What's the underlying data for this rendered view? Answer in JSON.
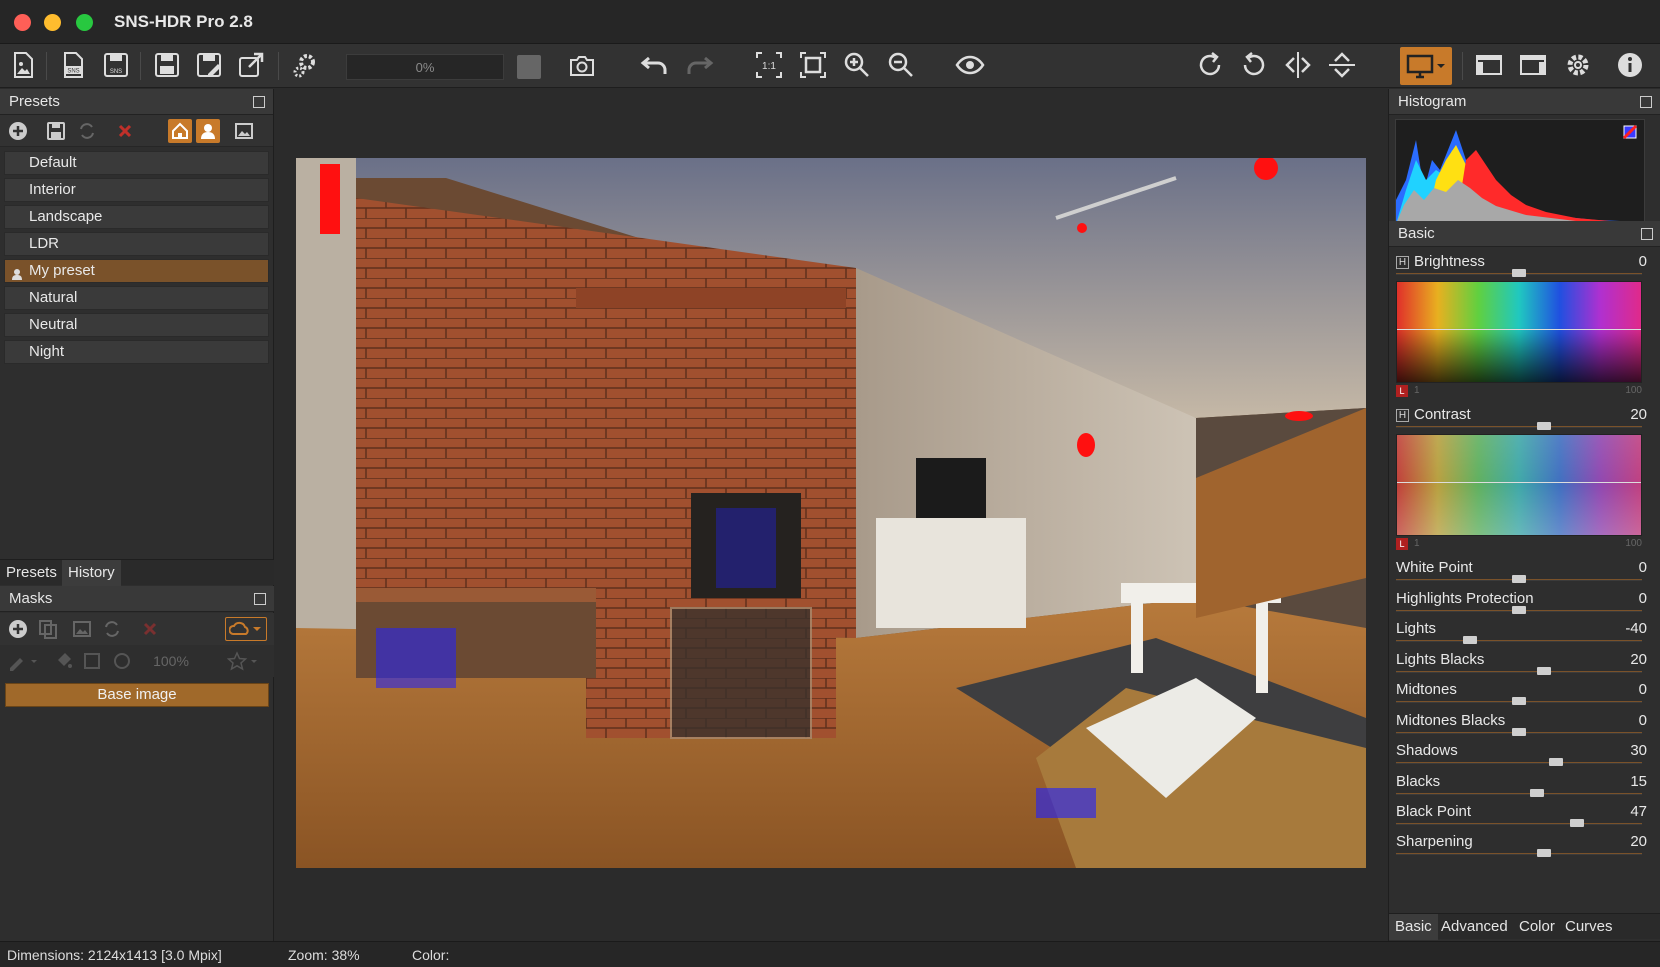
{
  "app": {
    "title": "SNS-HDR Pro 2.8"
  },
  "toolbar": {
    "progress_label": "0%",
    "buttons": [
      "open-image-icon",
      "save-sns-icon",
      "save-sns-as-icon",
      "save-icon",
      "save-as-icon",
      "export-icon",
      "batch-settings-icon",
      "snapshot-icon",
      "undo-icon",
      "redo-icon",
      "zoom-1-1-icon",
      "fit-screen-icon",
      "zoom-in-icon",
      "zoom-out-icon",
      "preview-eye-icon",
      "rotate-right-icon",
      "rotate-left-icon",
      "flip-horizontal-icon",
      "flip-vertical-icon",
      "display-mode-icon",
      "layout-1-icon",
      "layout-2-icon",
      "settings-gear-icon",
      "info-icon"
    ]
  },
  "presets": {
    "header": "Presets",
    "items": [
      {
        "label": "Default"
      },
      {
        "label": "Interior"
      },
      {
        "label": "Landscape"
      },
      {
        "label": "LDR"
      },
      {
        "label": "My preset"
      },
      {
        "label": "Natural"
      },
      {
        "label": "Neutral"
      },
      {
        "label": "Night"
      }
    ],
    "tab_presets": "Presets",
    "tab_history": "History"
  },
  "masks": {
    "header": "Masks",
    "opacity": "100%",
    "base_image": "Base image"
  },
  "histogram": {
    "header": "Histogram"
  },
  "basic": {
    "header": "Basic",
    "brightness": {
      "label": "Brightness",
      "value": "0",
      "level": 0.5
    },
    "contrast": {
      "label": "Contrast",
      "value": "20",
      "level": 0.6
    },
    "map_min": "1",
    "map_max": "100",
    "sliders": [
      {
        "label": "White Point",
        "value": "0",
        "level": 0.5
      },
      {
        "label": "Highlights Protection",
        "value": "0",
        "level": 0.5
      },
      {
        "label": "Lights",
        "value": "-40",
        "level": 0.3
      },
      {
        "label": "Lights Blacks",
        "value": "20",
        "level": 0.6
      },
      {
        "label": "Midtones",
        "value": "0",
        "level": 0.5
      },
      {
        "label": "Midtones Blacks",
        "value": "0",
        "level": 0.5
      },
      {
        "label": "Shadows",
        "value": "30",
        "level": 0.65
      },
      {
        "label": "Blacks",
        "value": "15",
        "level": 0.575
      },
      {
        "label": "Black Point",
        "value": "47",
        "level": 0.735
      },
      {
        "label": "Sharpening",
        "value": "20",
        "level": 0.6
      }
    ]
  },
  "right_tabs": [
    "Basic",
    "Advanced",
    "Color",
    "Curves"
  ],
  "status": {
    "dimensions": "Dimensions: 2124x1413 [3.0 Mpix]",
    "zoom": "Zoom: 38%",
    "color": "Color:"
  }
}
